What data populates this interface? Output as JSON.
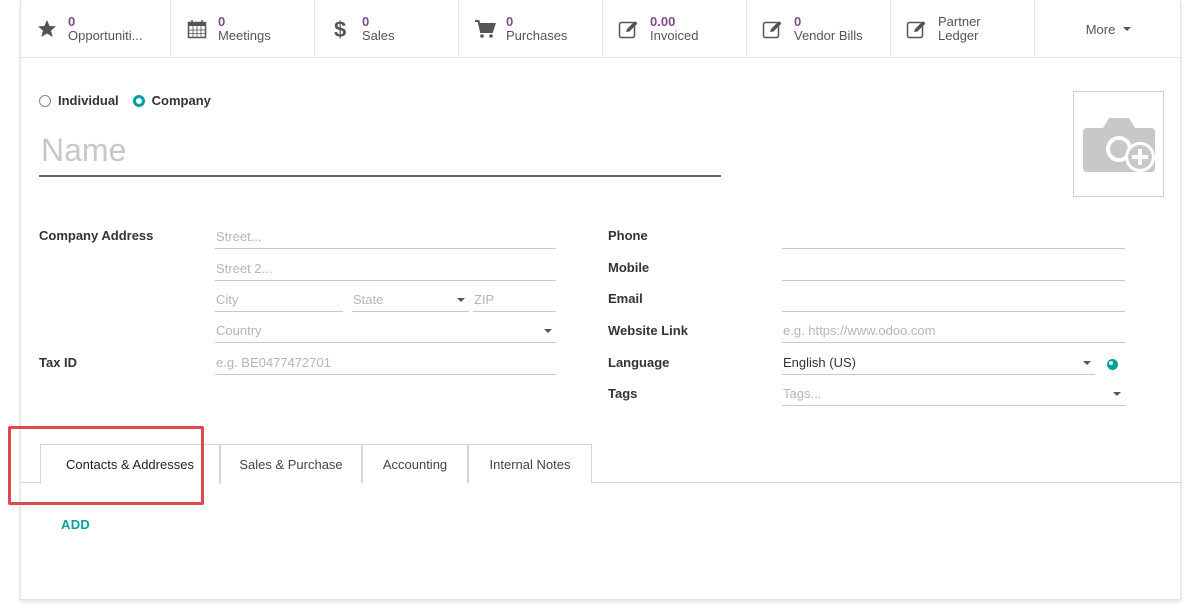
{
  "smart_buttons": [
    {
      "value": "0",
      "label": "Opportuniti...",
      "icon": "star-icon"
    },
    {
      "value": "0",
      "label": "Meetings",
      "icon": "calendar-icon"
    },
    {
      "value": "0",
      "label": "Sales",
      "icon": "dollar-icon"
    },
    {
      "value": "0",
      "label": "Purchases",
      "icon": "cart-icon"
    },
    {
      "value": "0.00",
      "label": "Invoiced",
      "icon": "edit-icon"
    },
    {
      "value": "0",
      "label": "Vendor Bills",
      "icon": "edit-icon"
    },
    {
      "value": "",
      "label": "Partner",
      "label2": "Ledger",
      "icon": "edit-icon"
    }
  ],
  "more_label": "More",
  "company_type": {
    "individual": "Individual",
    "company": "Company",
    "selected": "company"
  },
  "name_placeholder": "Name",
  "labels": {
    "company_address": "Company Address",
    "tax_id": "Tax ID",
    "phone": "Phone",
    "mobile": "Mobile",
    "email": "Email",
    "website": "Website Link",
    "language": "Language",
    "tags": "Tags"
  },
  "placeholders": {
    "street": "Street...",
    "street2": "Street 2...",
    "city": "City",
    "state": "State",
    "zip": "ZIP",
    "country": "Country",
    "tax_id": "e.g. BE0477472701",
    "website": "e.g. https://www.odoo.com",
    "tags": "Tags..."
  },
  "language_value": "English (US)",
  "tabs": [
    "Contacts & Addresses",
    "Sales & Purchase",
    "Accounting",
    "Internal Notes"
  ],
  "add_label": "ADD",
  "colors": {
    "accent": "#00a09d",
    "value_purple": "#7c4a85",
    "highlight": "#e0474f"
  }
}
